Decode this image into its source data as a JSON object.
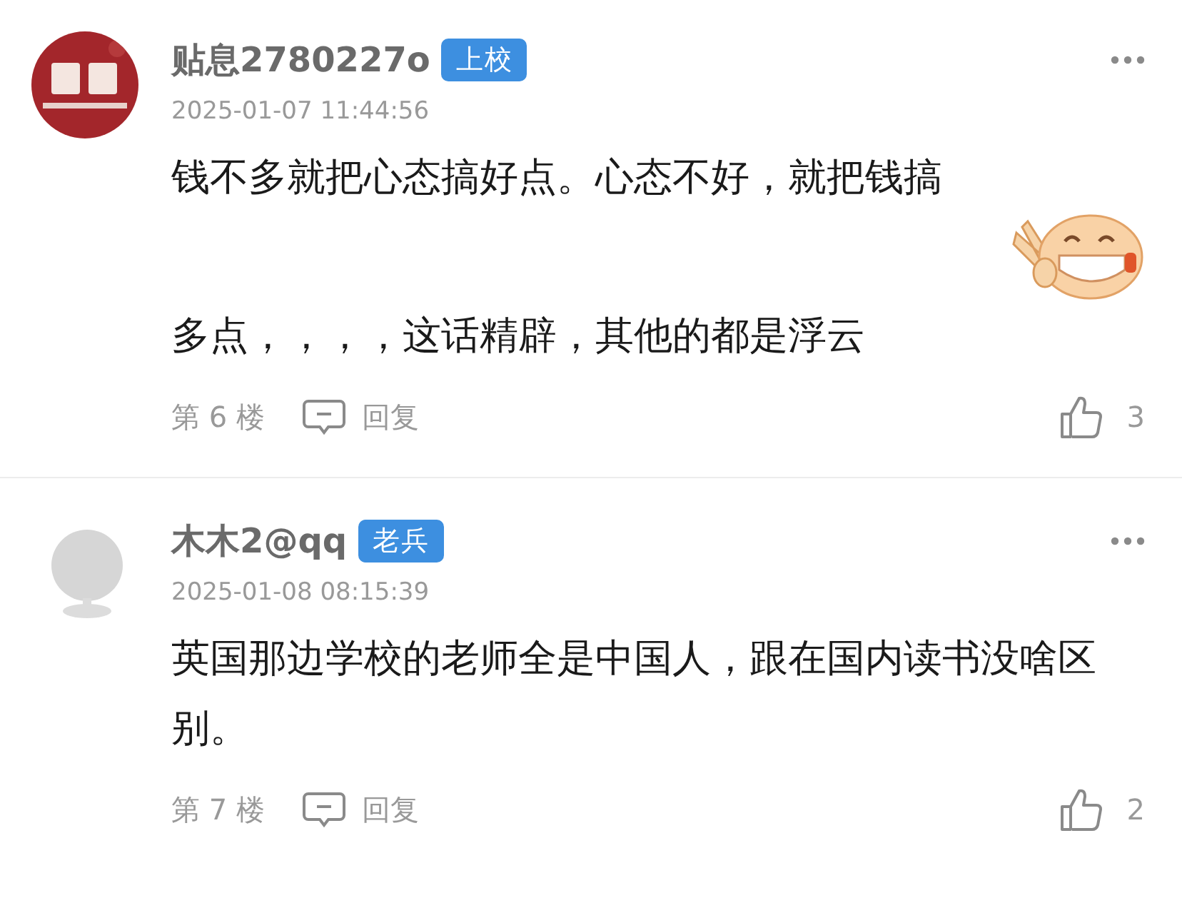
{
  "comments": [
    {
      "username": "贴息2780227o",
      "badge": "上校",
      "time": "2025-01-07 11:44:56",
      "body": [
        {
          "kind": "text",
          "text": "钱不多就把心态搞好点。心态不好，就把钱搞"
        },
        {
          "kind": "emoji"
        },
        {
          "kind": "text",
          "text": "多点，，，，这话精辟，其他的都是浮云"
        }
      ],
      "floor": "第 6 楼",
      "reply": "回复",
      "likes": "3"
    },
    {
      "avatar": {
        "kind": "default"
      },
      "username": "木木2@qq",
      "badge": "老兵",
      "time": "2025-01-08 08:15:39",
      "body": [
        {
          "kind": "text",
          "text": "英国那边学校的老师全是中国人，跟在国内读书没啥区别。"
        }
      ],
      "floor": "第 7 楼",
      "reply": "回复",
      "likes": "2"
    }
  ]
}
